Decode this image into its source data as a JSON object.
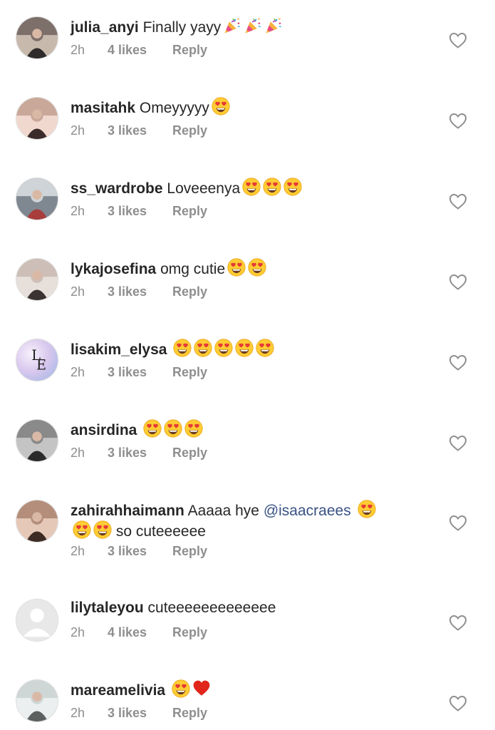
{
  "comments": [
    {
      "username": "julia_anyi",
      "text": "Finally yayy",
      "emojis": [
        "party",
        "party",
        "party"
      ],
      "time": "2h",
      "likes": "4 likes",
      "reply": "Reply",
      "avatar": "avatar-photo"
    },
    {
      "username": "masitahk",
      "text": "Omeyyyyy",
      "emojis": [
        "heart-eyes"
      ],
      "time": "2h",
      "likes": "3 likes",
      "reply": "Reply",
      "avatar": "avatar-photo"
    },
    {
      "username": "ss_wardrobe",
      "text": "Loveeenya",
      "emojis": [
        "heart-eyes",
        "heart-eyes",
        "heart-eyes"
      ],
      "time": "2h",
      "likes": "3 likes",
      "reply": "Reply",
      "avatar": "avatar-photo"
    },
    {
      "username": "lykajosefina",
      "text": "omg cutie",
      "emojis": [
        "heart-eyes",
        "heart-eyes"
      ],
      "time": "2h",
      "likes": "3 likes",
      "reply": "Reply",
      "avatar": "avatar-photo"
    },
    {
      "username": "lisakim_elysa",
      "text": "",
      "emojis": [
        "heart-eyes",
        "heart-eyes",
        "heart-eyes",
        "heart-eyes",
        "heart-eyes"
      ],
      "time": "2h",
      "likes": "3 likes",
      "reply": "Reply",
      "avatar": "avatar-logo",
      "avatar_text": "LE"
    },
    {
      "username": "ansirdina",
      "text": "",
      "emojis": [
        "heart-eyes",
        "heart-eyes",
        "heart-eyes"
      ],
      "time": "2h",
      "likes": "3 likes",
      "reply": "Reply",
      "avatar": "avatar-photo"
    },
    {
      "username": "zahirahhaimann",
      "text_before": "Aaaaa hye",
      "mention": "@isaacraees",
      "text_after": "so cuteeeeee",
      "time": "2h",
      "likes": "3 likes",
      "reply": "Reply",
      "avatar": "avatar-photo"
    },
    {
      "username": "lilytaleyou",
      "text": "cuteeeeeeeeeeeee",
      "emojis": [],
      "time": "2h",
      "likes": "4 likes",
      "reply": "Reply",
      "avatar": "avatar-default"
    },
    {
      "username": "mareamelivia",
      "text": "",
      "emojis": [
        "heart-eyes",
        "red-heart"
      ],
      "time": "2h",
      "likes": "3 likes",
      "reply": "Reply",
      "avatar": "avatar-photo"
    }
  ],
  "colors": {
    "text": "#262626",
    "secondary": "#8e8e8e",
    "mention": "#385185",
    "border": "#dbdbdb"
  }
}
